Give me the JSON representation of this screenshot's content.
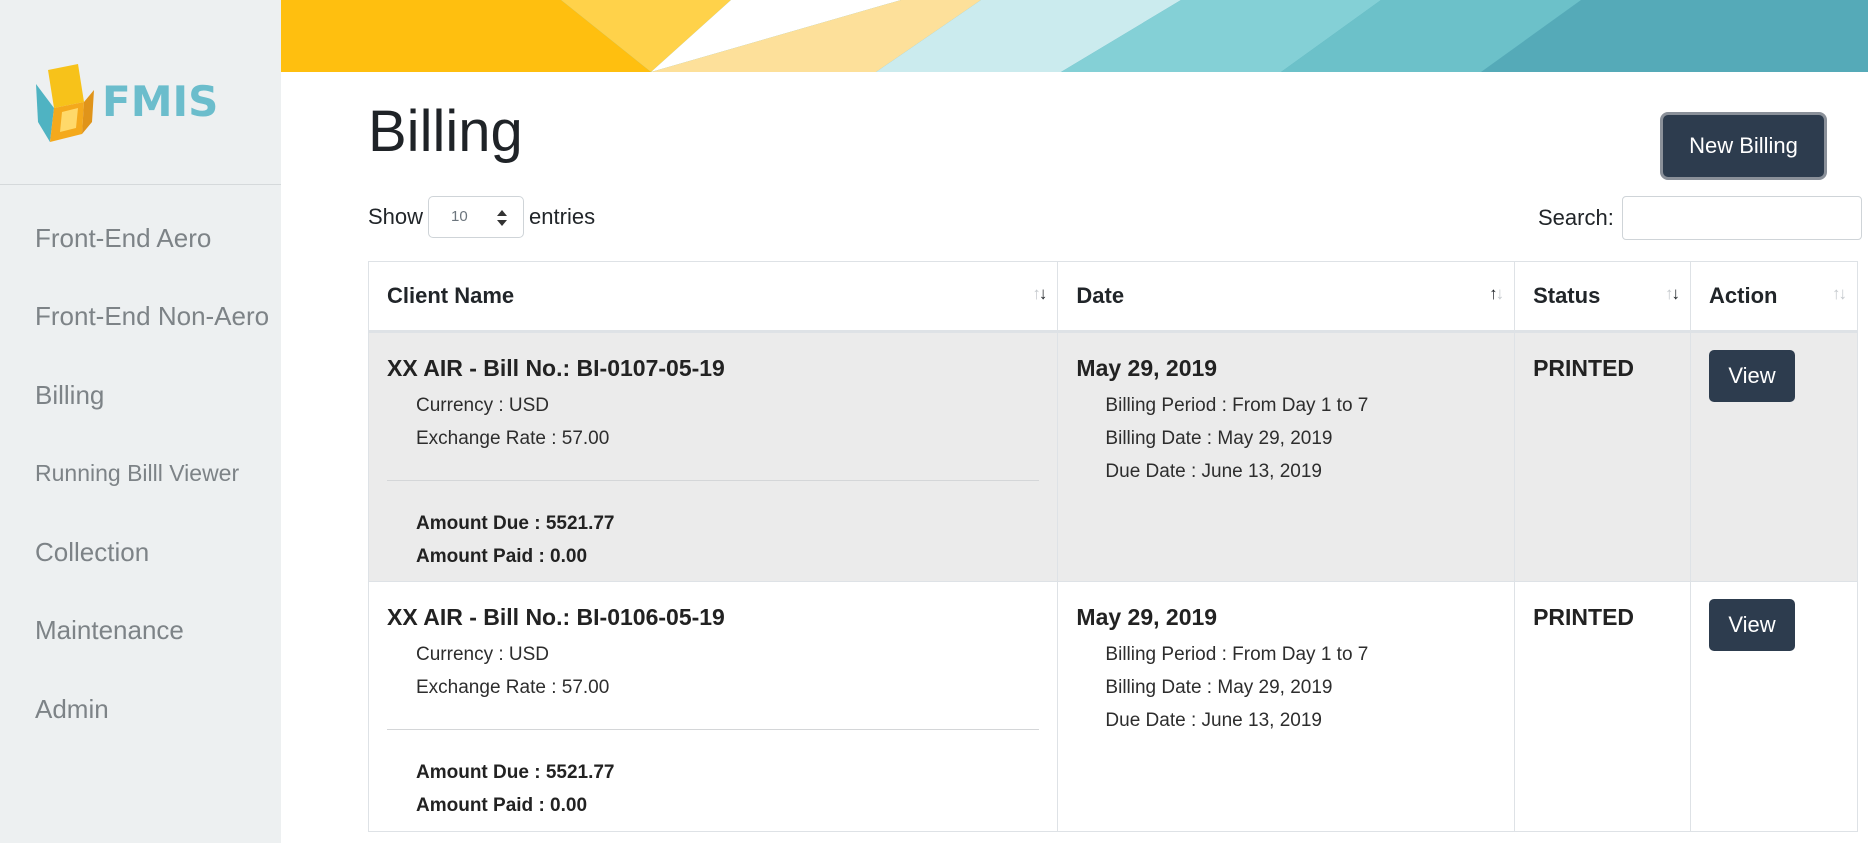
{
  "logo_text": "FMIS",
  "sidebar": {
    "items": [
      {
        "label": "Front-End Aero"
      },
      {
        "label": "Front-End Non-Aero"
      },
      {
        "label": "Billing"
      },
      {
        "label": "Running Billl Viewer"
      },
      {
        "label": "Collection"
      },
      {
        "label": "Maintenance"
      },
      {
        "label": "Admin"
      }
    ]
  },
  "page": {
    "title": "Billing",
    "new_button": "New Billing"
  },
  "controls": {
    "show_label": "Show",
    "entries_value": "10",
    "entries_label": "entries",
    "search_label": "Search:",
    "search_value": ""
  },
  "table": {
    "headers": [
      "Client Name",
      "Date",
      "Status",
      "Action"
    ],
    "rows": [
      {
        "client": "XX AIR - Bill No.: BI-0107-05-19",
        "currency": "Currency : USD",
        "exchange_rate": "Exchange Rate : 57.00",
        "amount_due": "Amount Due : 5521.77",
        "amount_paid": "Amount Paid : 0.00",
        "date": "May 29, 2019",
        "billing_period": "Billing Period : From Day 1 to 7",
        "billing_date": "Billing Date : May 29, 2019",
        "due_date": "Due Date : June 13, 2019",
        "status": "PRINTED",
        "action": "View"
      },
      {
        "client": "XX AIR - Bill No.: BI-0106-05-19",
        "currency": "Currency : USD",
        "exchange_rate": "Exchange Rate : 57.00",
        "amount_due": "Amount Due : 5521.77",
        "amount_paid": "Amount Paid : 0.00",
        "date": "May 29, 2019",
        "billing_period": "Billing Period : From Day 1 to 7",
        "billing_date": "Billing Date : May 29, 2019",
        "due_date": "Due Date : June 13, 2019",
        "status": "PRINTED",
        "action": "View"
      }
    ]
  },
  "colors": {
    "sidebar_bg": "#edf0f1",
    "button_bg": "#2d3c4e",
    "banner_yellow": "#ffc20e",
    "banner_teal": "#55aab8"
  }
}
